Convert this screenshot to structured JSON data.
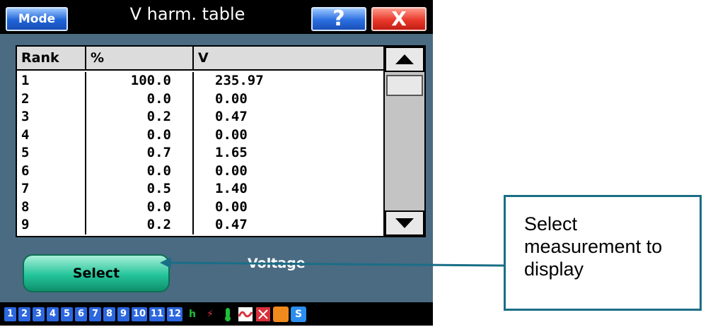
{
  "titlebar": {
    "mode_label": "Mode",
    "title": "V harm. table",
    "help_label": "?",
    "close_label": "X"
  },
  "table": {
    "headers": [
      "Rank",
      "%",
      "V"
    ],
    "rows": [
      {
        "rank": "1",
        "pct": "100.0",
        "v": "235.97"
      },
      {
        "rank": "2",
        "pct": "0.0",
        "v": "0.00"
      },
      {
        "rank": "3",
        "pct": "0.2",
        "v": "0.47"
      },
      {
        "rank": "4",
        "pct": "0.0",
        "v": "0.00"
      },
      {
        "rank": "5",
        "pct": "0.7",
        "v": "1.65"
      },
      {
        "rank": "6",
        "pct": "0.0",
        "v": "0.00"
      },
      {
        "rank": "7",
        "pct": "0.5",
        "v": "1.40"
      },
      {
        "rank": "8",
        "pct": "0.0",
        "v": "0.00"
      },
      {
        "rank": "9",
        "pct": "0.2",
        "v": "0.47"
      }
    ]
  },
  "controls": {
    "select_label": "Select",
    "measurement_label": "Voltage"
  },
  "statusbar": {
    "channels": [
      "1",
      "2",
      "3",
      "4",
      "5",
      "6",
      "7",
      "8",
      "9",
      "10",
      "11",
      "12"
    ],
    "icons": [
      {
        "name": "hold-icon",
        "color": "#1fbf3a",
        "glyph": "h"
      },
      {
        "name": "link-error-icon",
        "color": "#d8323c",
        "glyph": "⚡"
      },
      {
        "name": "temperature-icon",
        "color": "#1fbf3a",
        "glyph": "🌡"
      },
      {
        "name": "signal-error-icon",
        "color": "#d8323c",
        "glyph": "∿"
      },
      {
        "name": "alarm-icon",
        "color": "#d8323c",
        "glyph": "⊠"
      },
      {
        "name": "battery-icon",
        "color": "#f08a1c",
        "glyph": ""
      },
      {
        "name": "sd-icon",
        "color": "#2c8ef0",
        "glyph": "S"
      }
    ]
  },
  "callout": {
    "text": "Select measurement to display"
  },
  "colors": {
    "device_bg": "#4a6b82",
    "accent_blue": "#2c67e0",
    "select_green": "#24c49a",
    "callout_border": "#1a6e86"
  }
}
